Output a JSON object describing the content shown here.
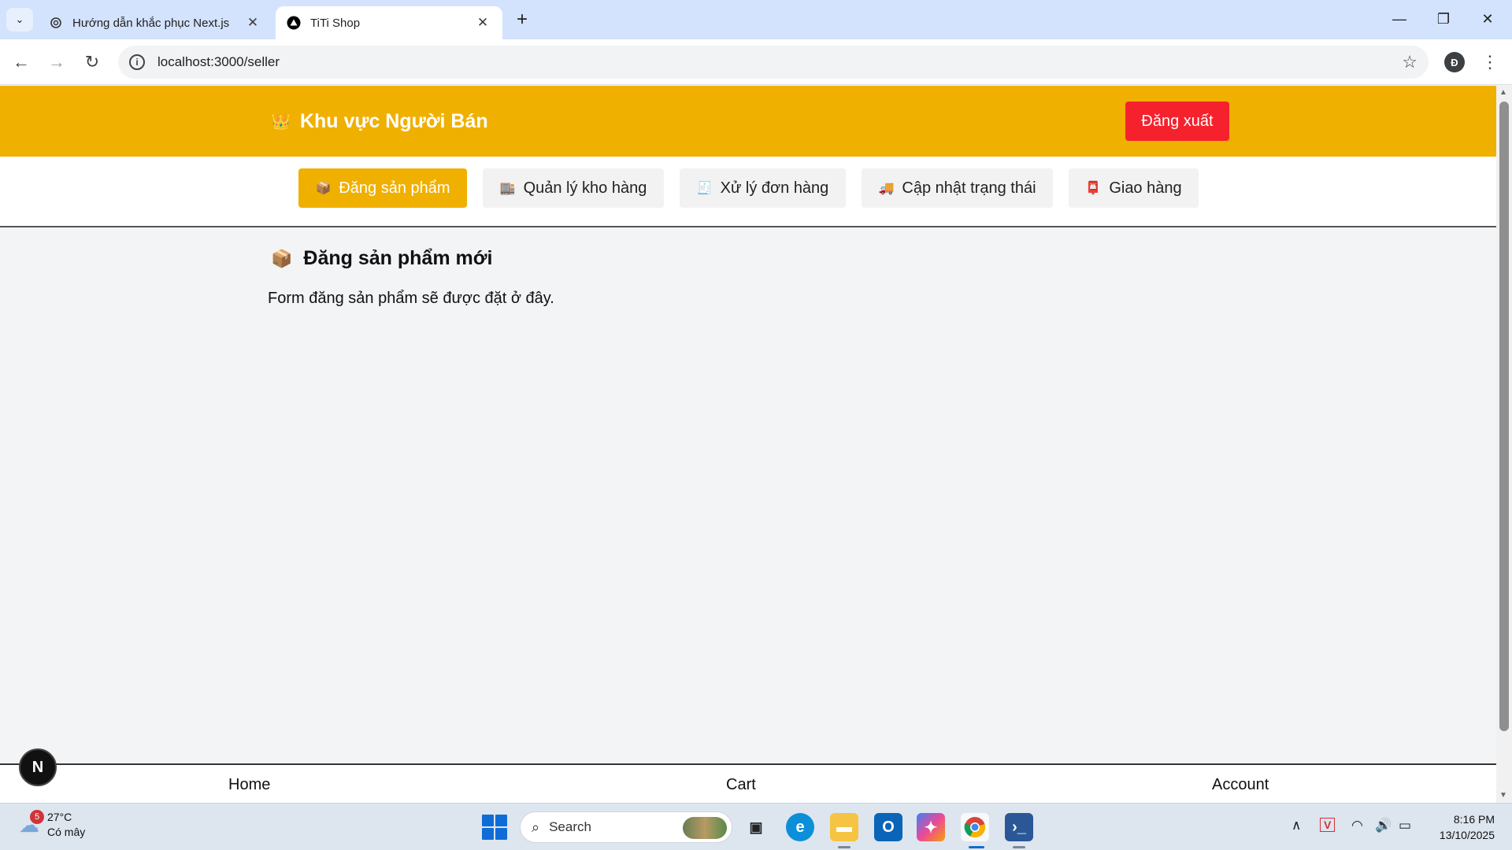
{
  "browser": {
    "tabs": [
      {
        "title": "Hướng dẫn khắc phục Next.js",
        "favicon": "openai-icon",
        "active": false
      },
      {
        "title": "TiTi Shop",
        "favicon": "nextjs-triangle-icon",
        "active": true
      }
    ],
    "close_glyph": "✕",
    "new_tab_glyph": "+",
    "url": "localhost:3000/seller",
    "profile_initial": "Đ"
  },
  "header": {
    "brand_icon": "👑",
    "brand": "Khu vực Người Bán",
    "logout_label": "Đăng xuất",
    "accent_color": "#f0b000",
    "logout_color": "#f5222d"
  },
  "nav": {
    "tabs": [
      {
        "icon": "📦",
        "label": "Đăng sản phẩm",
        "active": true
      },
      {
        "icon": "🏬",
        "label": "Quản lý kho hàng",
        "active": false
      },
      {
        "icon": "🧾",
        "label": "Xử lý đơn hàng",
        "active": false
      },
      {
        "icon": "🚚",
        "label": "Cập nhật trạng thái",
        "active": false
      },
      {
        "icon": "📮",
        "label": "Giao hàng",
        "active": false
      }
    ]
  },
  "content": {
    "title_icon": "📦",
    "title": "Đăng sản phẩm mới",
    "description": "Form đăng sản phẩm sẽ được đặt ở đây."
  },
  "footer": {
    "links": [
      "Home",
      "Cart",
      "Account"
    ]
  },
  "nextjs_badge": "N",
  "taskbar": {
    "weather": {
      "badge": "5",
      "temp": "27°C",
      "condition": "Có mây"
    },
    "search_placeholder": "Search",
    "time": "8:16 PM",
    "date": "13/10/2025"
  }
}
